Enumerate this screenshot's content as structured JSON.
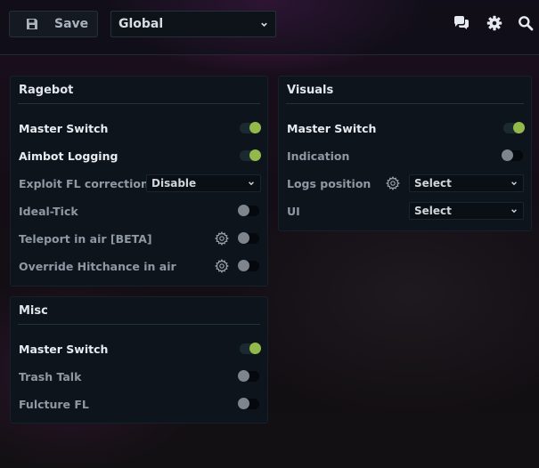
{
  "topbar": {
    "save_label": "Save",
    "config_select": "Global",
    "icons": [
      "save-icon",
      "chat-icon",
      "gear-icon",
      "search-icon"
    ]
  },
  "colors": {
    "accent": "#93b94a",
    "panel": "#0d141c",
    "text": "#e8ecf0",
    "muted": "#8f98a3"
  },
  "ragebot": {
    "title": "Ragebot",
    "master_switch": {
      "label": "Master Switch",
      "enabled": true
    },
    "aimbot_logging": {
      "label": "Aimbot Logging",
      "enabled": true
    },
    "exploit_fl": {
      "label": "Exploit FL correction",
      "value": "Disable"
    },
    "ideal_tick": {
      "label": "Ideal-Tick",
      "enabled": false
    },
    "teleport": {
      "label": "Teleport in air [BETA]",
      "enabled": false
    },
    "override_hitchance": {
      "label": "Override Hitchance in air",
      "enabled": false
    }
  },
  "misc": {
    "title": "Misc",
    "master_switch": {
      "label": "Master Switch",
      "enabled": true
    },
    "trash_talk": {
      "label": "Trash Talk",
      "enabled": false
    },
    "fulcture_fl": {
      "label": "Fulcture FL",
      "enabled": false
    }
  },
  "visuals": {
    "title": "Visuals",
    "master_switch": {
      "label": "Master Switch",
      "enabled": true
    },
    "indication": {
      "label": "Indication",
      "enabled": false
    },
    "logs_position": {
      "label": "Logs position",
      "value": "Select"
    },
    "ui": {
      "label": "UI",
      "value": "Select"
    }
  }
}
